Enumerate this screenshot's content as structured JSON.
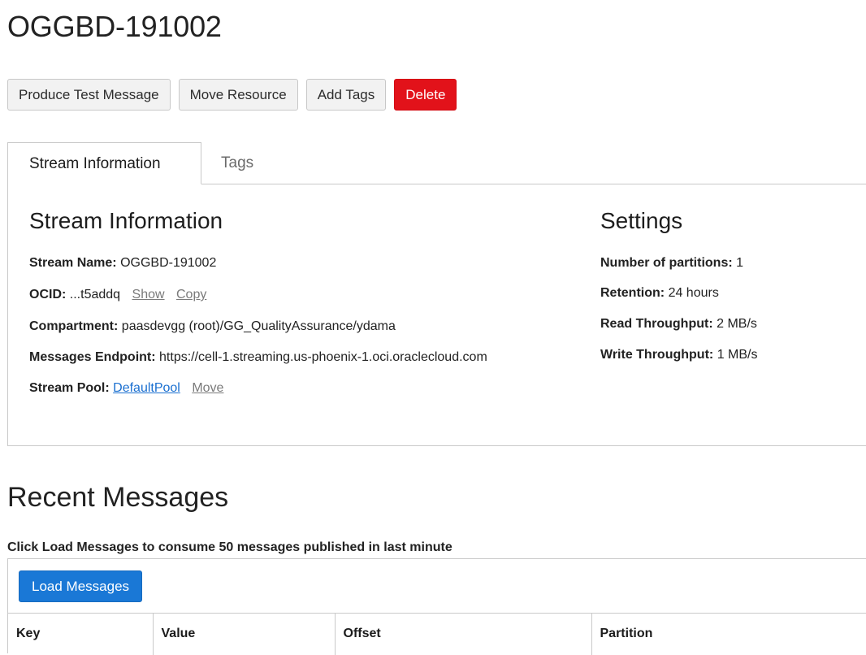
{
  "header": {
    "title": "OGGBD-191002"
  },
  "actions": {
    "produce_label": "Produce Test Message",
    "move_label": "Move Resource",
    "tags_label": "Add Tags",
    "delete_label": "Delete"
  },
  "tabs": [
    {
      "label": "Stream Information",
      "active": true
    },
    {
      "label": "Tags",
      "active": false
    }
  ],
  "stream_info": {
    "title": "Stream Information",
    "name_label": "Stream Name:",
    "name_value": "OGGBD-191002",
    "ocid_label": "OCID:",
    "ocid_value": "...t5addq",
    "ocid_show": "Show",
    "ocid_copy": "Copy",
    "compartment_label": "Compartment:",
    "compartment_value": "paasdevgg (root)/GG_QualityAssurance/ydama",
    "endpoint_label": "Messages Endpoint:",
    "endpoint_value": "https://cell-1.streaming.us-phoenix-1.oci.oraclecloud.com",
    "pool_label": "Stream Pool:",
    "pool_value": "DefaultPool",
    "pool_move": "Move"
  },
  "settings": {
    "title": "Settings",
    "partitions_label": "Number of partitions:",
    "partitions_value": "1",
    "retention_label": "Retention:",
    "retention_value": "24 hours",
    "read_label": "Read Throughput:",
    "read_value": "2 MB/s",
    "write_label": "Write Throughput:",
    "write_value": "1 MB/s"
  },
  "recent": {
    "title": "Recent Messages",
    "hint": "Click Load Messages to consume 50 messages published in last minute",
    "load_label": "Load Messages",
    "columns": [
      "Key",
      "Value",
      "Offset",
      "Partition"
    ]
  },
  "colors": {
    "danger": "#e2121a",
    "primary": "#1a78d6",
    "link": "#1a6fd0"
  }
}
